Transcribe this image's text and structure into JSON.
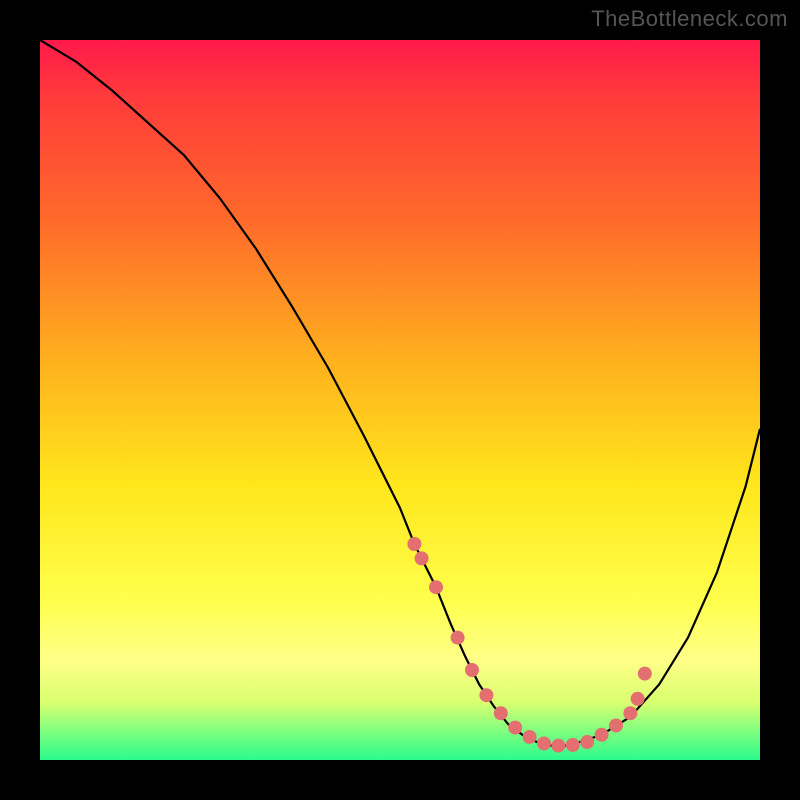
{
  "watermark": "TheBottleneck.com",
  "colors": {
    "background": "#000000",
    "curve_stroke": "#000000",
    "dot_fill": "#e36f70",
    "gradient_top": "#ff1a4b",
    "gradient_bottom": "#2bfb8c"
  },
  "chart_data": {
    "type": "line",
    "title": "",
    "xlabel": "",
    "ylabel": "",
    "xlim": [
      0,
      100
    ],
    "ylim": [
      0,
      100
    ],
    "series": [
      {
        "name": "bottleneck-curve",
        "x": [
          0,
          5,
          10,
          15,
          20,
          25,
          30,
          35,
          40,
          45,
          50,
          52,
          55,
          57,
          59,
          61,
          63,
          65,
          67,
          69,
          71,
          73,
          75,
          78,
          82,
          86,
          90,
          94,
          98,
          100
        ],
        "y": [
          100,
          97,
          93,
          88.5,
          84,
          78,
          71,
          63,
          54.5,
          45,
          35,
          30,
          24,
          19,
          14.5,
          10.5,
          7.5,
          5,
          3.5,
          2.5,
          2,
          2,
          2.5,
          3.5,
          6,
          10.5,
          17,
          26,
          38,
          46
        ]
      }
    ],
    "dots": {
      "name": "highlight-dots",
      "x": [
        52,
        53,
        55,
        58,
        60,
        62,
        64,
        66,
        68,
        70,
        72,
        74,
        76,
        78,
        80,
        82,
        83,
        84
      ],
      "y": [
        30,
        28,
        24,
        17,
        12.5,
        9,
        6.5,
        4.5,
        3.2,
        2.3,
        2,
        2.1,
        2.5,
        3.5,
        4.8,
        6.5,
        8.5,
        12
      ]
    }
  }
}
